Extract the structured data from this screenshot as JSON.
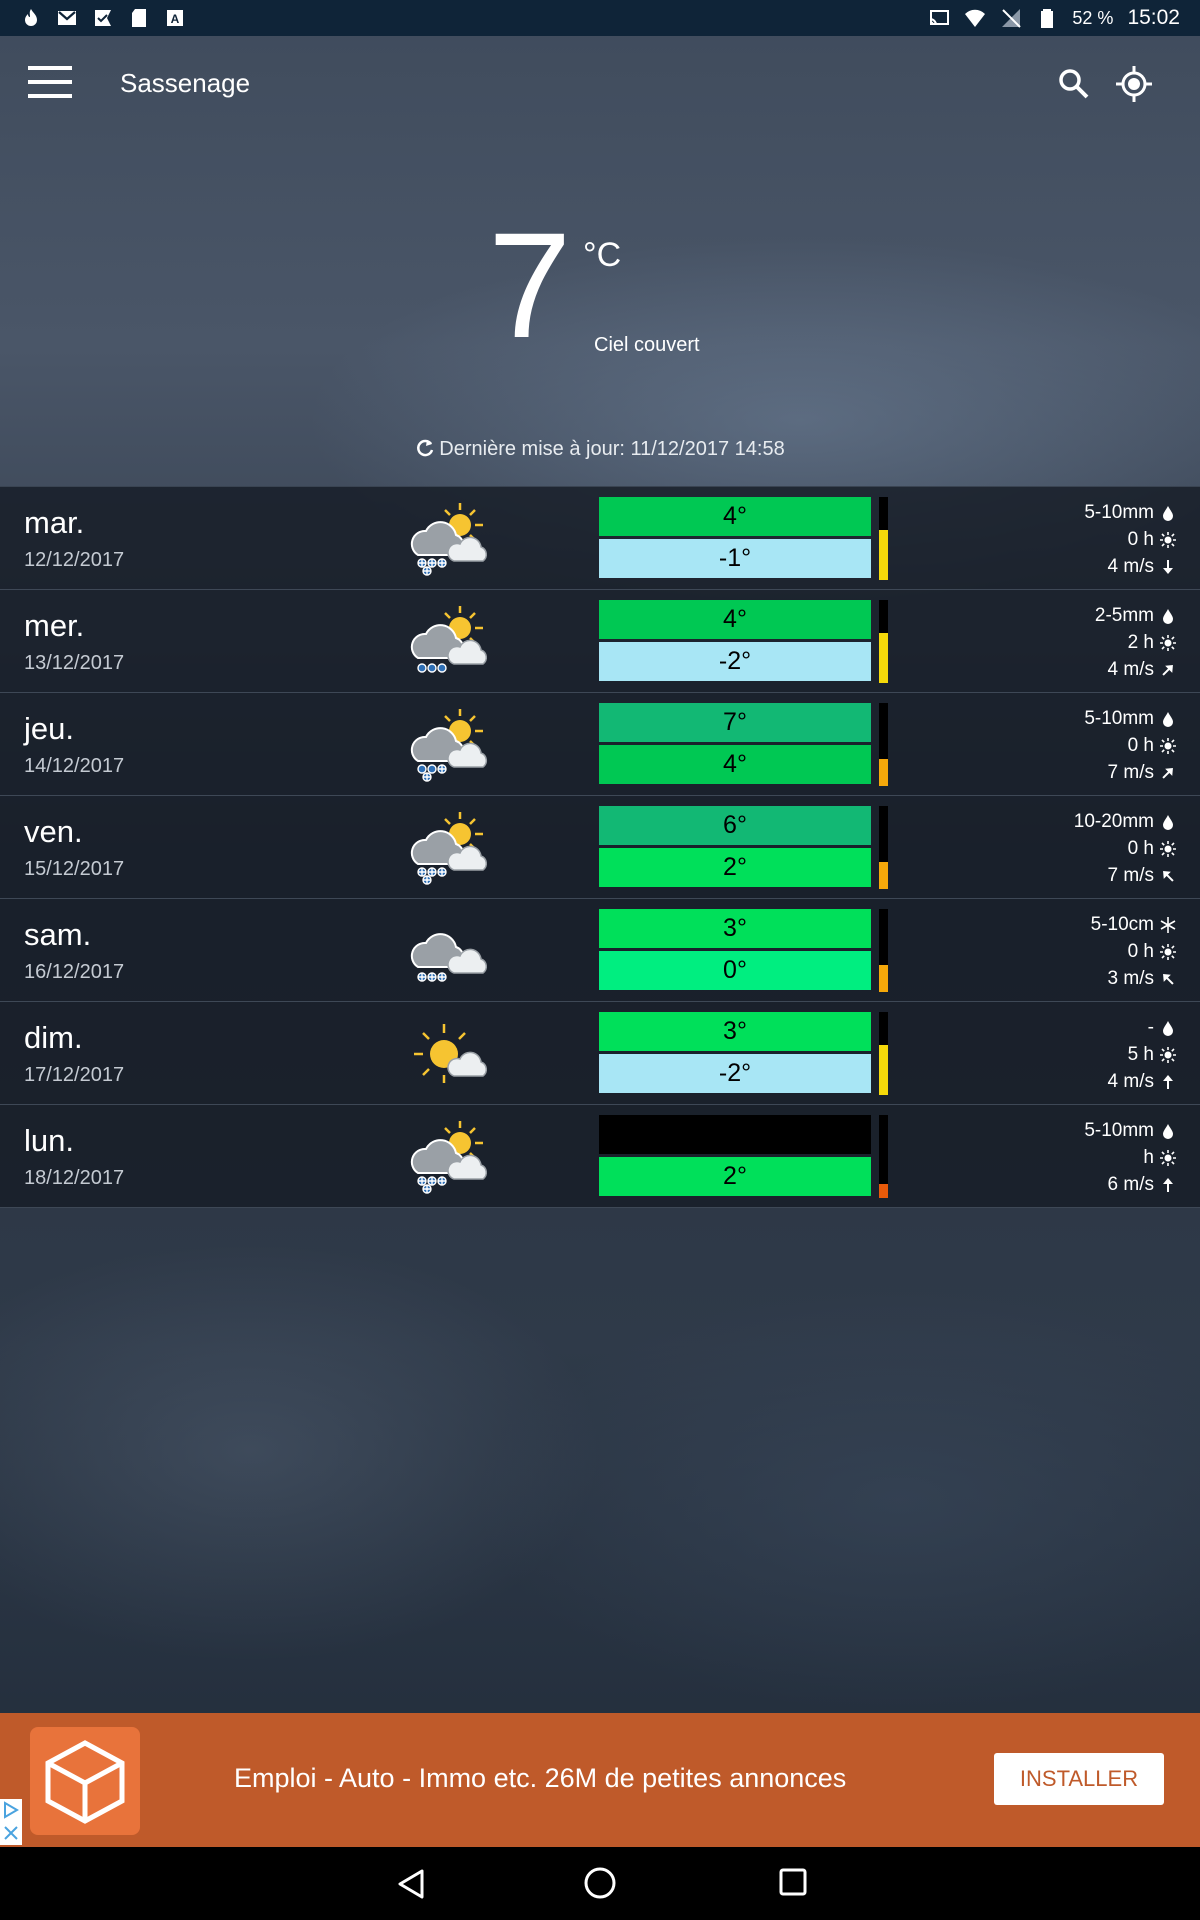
{
  "status_bar": {
    "battery": "52 %",
    "time": "15:02"
  },
  "header": {
    "location": "Sassenage"
  },
  "current": {
    "temperature": "7",
    "unit": "°C",
    "condition": "Ciel couvert",
    "updated": "Dernière mise à jour: 11/12/2017 14:58"
  },
  "forecast": [
    {
      "day": "mar.",
      "date": "12/12/2017",
      "icon": "sun-cloud-snow-icon",
      "high": "4°",
      "low": "-1°",
      "high_color": "#00c853",
      "low_color": "#a8e6f5",
      "level_color": "#f5d90a",
      "level": 0.6,
      "precip": "5-10mm",
      "precip_icon": "drop-icon",
      "sun": "0 h",
      "wind": "4 m/s",
      "wind_icon": "wind-arrow-icon"
    },
    {
      "day": "mer.",
      "date": "13/12/2017",
      "icon": "sun-cloud-rain-icon",
      "high": "4°",
      "low": "-2°",
      "high_color": "#00c853",
      "low_color": "#a8e6f5",
      "level_color": "#f5d90a",
      "level": 0.6,
      "precip": "2-5mm",
      "precip_icon": "drop-icon",
      "sun": "2 h",
      "wind": "4 m/s",
      "wind_icon": "wind-arrow-icon"
    },
    {
      "day": "jeu.",
      "date": "14/12/2017",
      "icon": "sun-cloud-rain-snow-icon",
      "high": "7°",
      "low": "4°",
      "high_color": "#12b874",
      "low_color": "#00c853",
      "level_color": "#f5a80a",
      "level": 0.33,
      "precip": "5-10mm",
      "precip_icon": "drop-icon",
      "sun": "0 h",
      "wind": "7 m/s",
      "wind_icon": "wind-arrow-icon"
    },
    {
      "day": "ven.",
      "date": "15/12/2017",
      "icon": "sun-cloud-snow-icon",
      "high": "6°",
      "low": "2°",
      "high_color": "#12b874",
      "low_color": "#00e05a",
      "level_color": "#f5a80a",
      "level": 0.33,
      "precip": "10-20mm",
      "precip_icon": "drop-icon",
      "sun": "0 h",
      "wind": "7 m/s",
      "wind_icon": "wind-arrow-icon"
    },
    {
      "day": "sam.",
      "date": "16/12/2017",
      "icon": "cloud-snow-icon",
      "high": "3°",
      "low": "0°",
      "high_color": "#00e05a",
      "low_color": "#00ee80",
      "level_color": "#f5a80a",
      "level": 0.33,
      "precip": "5-10cm",
      "precip_icon": "snowflake-icon",
      "sun": "0 h",
      "wind": "3 m/s",
      "wind_icon": "wind-arrow-icon"
    },
    {
      "day": "dim.",
      "date": "17/12/2017",
      "icon": "sun-cloud-icon",
      "high": "3°",
      "low": "-2°",
      "high_color": "#00e05a",
      "low_color": "#a8e6f5",
      "level_color": "#f5d90a",
      "level": 0.6,
      "precip": "-",
      "precip_icon": "drop-icon",
      "sun": "5 h",
      "wind": "4 m/s",
      "wind_icon": "wind-arrow-icon"
    },
    {
      "day": "lun.",
      "date": "18/12/2017",
      "icon": "sun-cloud-snow-icon",
      "high": "",
      "low": "2°",
      "high_color": "#000000",
      "low_color": "#00e05a",
      "level_color": "#e85a0a",
      "level": 0.17,
      "precip": "5-10mm",
      "precip_icon": "drop-icon",
      "sun": "h",
      "wind": "6 m/s",
      "wind_icon": "wind-arrow-icon"
    }
  ],
  "ad": {
    "text": "Emploi - Auto - Immo etc. 26M de petites annonces",
    "install_label": "INSTALLER"
  }
}
